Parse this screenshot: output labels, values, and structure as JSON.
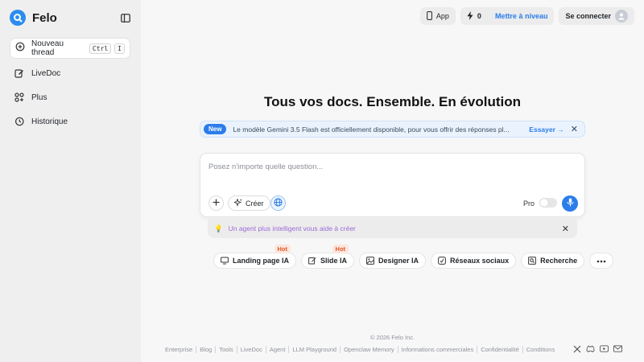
{
  "brand": {
    "name": "Felo"
  },
  "sidebar": {
    "new_thread": {
      "label": "Nouveau thread",
      "kbd1": "Ctrl",
      "kbd2": "I"
    },
    "items": [
      {
        "label": "LiveDoc",
        "icon": "edit-icon"
      },
      {
        "label": "Plus",
        "icon": "apps-icon"
      },
      {
        "label": "Historique",
        "icon": "history-icon"
      }
    ]
  },
  "topbar": {
    "app_label": "App",
    "credits": "0",
    "upgrade_label": "Mettre à niveau",
    "login_label": "Se connecter"
  },
  "main": {
    "headline": "Tous vos docs. Ensemble. En évolution",
    "banner": {
      "badge": "New",
      "text": "Le modèle Gemini 3.5 Flash est officiellement disponible, pour vous offrir des réponses pl...",
      "cta": "Essayer →",
      "close": "✕"
    },
    "composer": {
      "placeholder": "Posez n'importe quelle question...",
      "create_label": "Créer",
      "pro_label": "Pro"
    },
    "tip": {
      "icon": "💡",
      "text": "Un agent plus intelligent vous aide à créer",
      "close": "✕"
    },
    "chips": [
      {
        "label": "Landing page IA",
        "hot": "Hot",
        "icon": "monitor-icon"
      },
      {
        "label": "Slide IA",
        "hot": "Hot",
        "icon": "slide-edit-icon"
      },
      {
        "label": "Designer IA",
        "hot": "",
        "icon": "image-icon"
      },
      {
        "label": "Réseaux sociaux",
        "hot": "",
        "icon": "share-icon"
      },
      {
        "label": "Recherche",
        "hot": "",
        "icon": "research-icon"
      }
    ]
  },
  "footer": {
    "copyright": "© 2026  Felo Inc.",
    "links": [
      "Enterprise",
      "Blog",
      "Tools",
      "LiveDoc",
      "Agent",
      "LLM Playground",
      "Openclaw Memory",
      "Informations commerciales",
      "Confidentialité",
      "Conditions"
    ]
  },
  "colors": {
    "accent": "#2b7de9",
    "hot": "#e0572a",
    "tip_text": "#9c6bd6"
  }
}
